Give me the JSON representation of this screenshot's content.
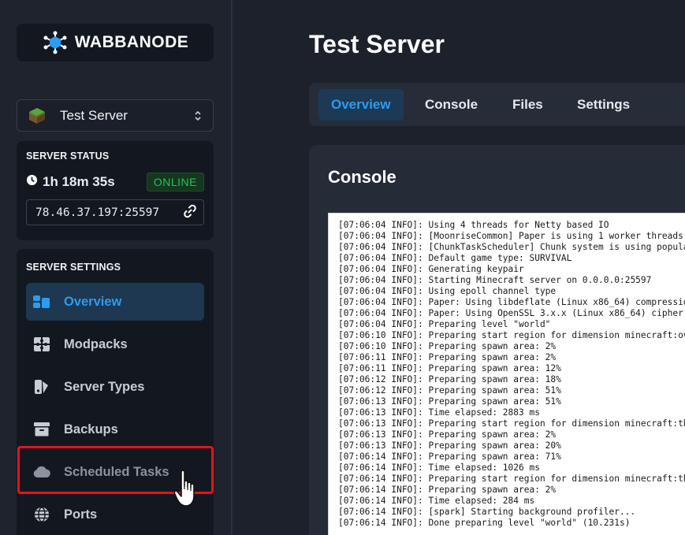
{
  "brand": {
    "name": "WABBANODE"
  },
  "server_select": {
    "label": "Test Server"
  },
  "server_status": {
    "title": "SERVER STATUS",
    "uptime": "1h 18m 35s",
    "status": "ONLINE",
    "address": "78.46.37.197:25597"
  },
  "server_settings": {
    "title": "SERVER SETTINGS",
    "items": [
      {
        "label": "Overview",
        "icon": "overview-icon",
        "active": true
      },
      {
        "label": "Modpacks",
        "icon": "puzzle-icon"
      },
      {
        "label": "Server Types",
        "icon": "server-types-icon"
      },
      {
        "label": "Backups",
        "icon": "archive-icon"
      },
      {
        "label": "Scheduled Tasks",
        "icon": "cloud-icon"
      },
      {
        "label": "Ports",
        "icon": "globe-icon"
      }
    ]
  },
  "main": {
    "title": "Test Server",
    "tabs": [
      {
        "label": "Overview",
        "active": true
      },
      {
        "label": "Console"
      },
      {
        "label": "Files"
      },
      {
        "label": "Settings"
      }
    ],
    "console": {
      "title": "Console",
      "lines": [
        "[07:06:04 INFO]: Using 4 threads for Netty based IO",
        "[07:06:04 INFO]: [MoonriseCommon] Paper is using 1 worker threads,",
        "[07:06:04 INFO]: [ChunkTaskScheduler] Chunk system is using populat",
        "[07:06:04 INFO]: Default game type: SURVIVAL",
        "[07:06:04 INFO]: Generating keypair",
        "[07:06:04 INFO]: Starting Minecraft server on 0.0.0.0:25597",
        "[07:06:04 INFO]: Using epoll channel type",
        "[07:06:04 INFO]: Paper: Using libdeflate (Linux x86_64) compression",
        "[07:06:04 INFO]: Paper: Using OpenSSL 3.x.x (Linux x86_64) cipher f",
        "[07:06:04 INFO]: Preparing level \"world\"",
        "[07:06:10 INFO]: Preparing start region for dimension minecraft:ove",
        "[07:06:10 INFO]: Preparing spawn area: 2%",
        "[07:06:11 INFO]: Preparing spawn area: 2%",
        "[07:06:11 INFO]: Preparing spawn area: 12%",
        "[07:06:12 INFO]: Preparing spawn area: 18%",
        "[07:06:12 INFO]: Preparing spawn area: 51%",
        "[07:06:13 INFO]: Preparing spawn area: 51%",
        "[07:06:13 INFO]: Time elapsed: 2883 ms",
        "[07:06:13 INFO]: Preparing start region for dimension minecraft:the",
        "[07:06:13 INFO]: Preparing spawn area: 2%",
        "[07:06:13 INFO]: Preparing spawn area: 20%",
        "[07:06:14 INFO]: Preparing spawn area: 71%",
        "[07:06:14 INFO]: Time elapsed: 1026 ms",
        "[07:06:14 INFO]: Preparing start region for dimension minecraft:the",
        "[07:06:14 INFO]: Preparing spawn area: 2%",
        "[07:06:14 INFO]: Time elapsed: 284 ms",
        "[07:06:14 INFO]: [spark] Starting background profiler...",
        "[07:06:14 INFO]: Done preparing level \"world\" (10.231s)"
      ]
    }
  },
  "colors": {
    "accent": "#2d9bf0",
    "online": "#27c25a",
    "highlight": "#e3141a"
  }
}
